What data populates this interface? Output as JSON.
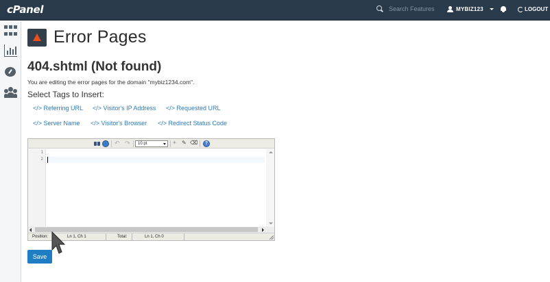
{
  "topbar": {
    "logo": "cPanel",
    "search_placeholder": "Search Features",
    "username": "MYBIZ123",
    "logout_label": "LOGOUT"
  },
  "sidebar": {
    "items": [
      {
        "icon": "grid-icon"
      },
      {
        "icon": "stats-icon"
      },
      {
        "icon": "gauge-icon"
      },
      {
        "icon": "users-icon"
      }
    ]
  },
  "page": {
    "title": "Error Pages",
    "file_title": "404.shtml (Not found)",
    "description": "You are editing the error pages for the domain \"mybiz1234.com\".",
    "select_tags_label": "Select Tags to Insert:"
  },
  "tags": [
    "</> Referring URL",
    "</> Visitor's IP Address",
    "</> Requested URL",
    "</> Server Name",
    "</> Visitor's Browser",
    "</> Redirect Status Code"
  ],
  "editor": {
    "font_size": "10 pt",
    "line_numbers": [
      "1",
      "2"
    ],
    "status": {
      "position_label": "Position:",
      "position_value": "Ln 1, Ch 1",
      "total_label": "Total:",
      "total_value": "Ln 1, Ch 0"
    }
  },
  "actions": {
    "save_label": "Save"
  },
  "colors": {
    "topbar_bg": "#293a4a",
    "link": "#2d7ab8",
    "primary_button": "#1f7dc4",
    "warning_icon": "#e8501c"
  }
}
